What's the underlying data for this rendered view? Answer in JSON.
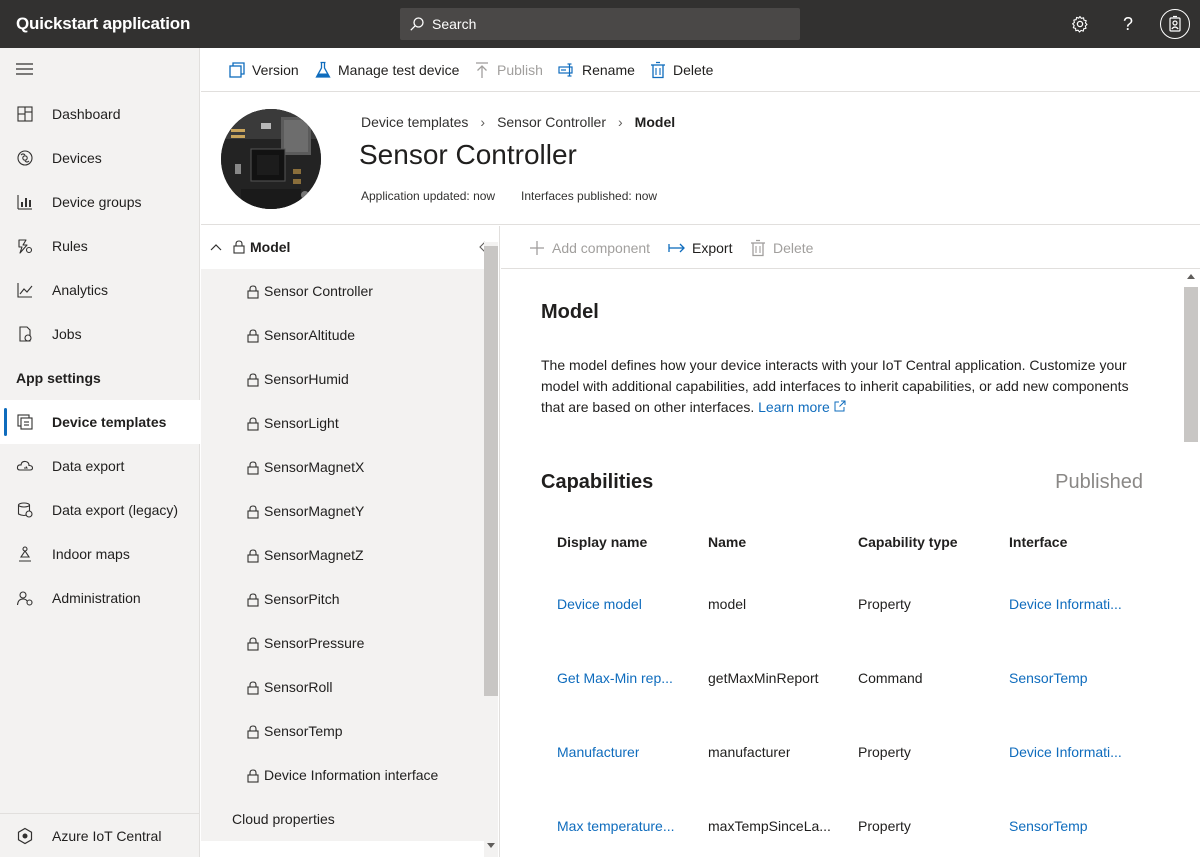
{
  "app": {
    "title": "Quickstart application"
  },
  "search": {
    "placeholder": "Search"
  },
  "sidebar": {
    "items": [
      {
        "label": "Dashboard"
      },
      {
        "label": "Devices"
      },
      {
        "label": "Device groups"
      },
      {
        "label": "Rules"
      },
      {
        "label": "Analytics"
      },
      {
        "label": "Jobs"
      }
    ],
    "section": "App settings",
    "settings_items": [
      {
        "label": "Device templates"
      },
      {
        "label": "Data export"
      },
      {
        "label": "Data export (legacy)"
      },
      {
        "label": "Indoor maps"
      },
      {
        "label": "Administration"
      }
    ],
    "footer": "Azure IoT Central"
  },
  "toolbar": {
    "version": "Version",
    "manage_test_device": "Manage test device",
    "publish": "Publish",
    "rename": "Rename",
    "delete": "Delete"
  },
  "header": {
    "breadcrumb": [
      "Device templates",
      "Sensor Controller",
      "Model"
    ],
    "title": "Sensor Controller",
    "app_updated": "Application updated: now",
    "interfaces_published": "Interfaces published: now"
  },
  "tree": {
    "root": "Model",
    "items": [
      "Sensor Controller",
      "SensorAltitude",
      "SensorHumid",
      "SensorLight",
      "SensorMagnetX",
      "SensorMagnetY",
      "SensorMagnetZ",
      "SensorPitch",
      "SensorPressure",
      "SensorRoll",
      "SensorTemp",
      "Device Information interface"
    ],
    "cloud": "Cloud properties"
  },
  "pane_toolbar": {
    "add_component": "Add component",
    "export": "Export",
    "delete": "Delete"
  },
  "content": {
    "heading": "Model",
    "description": "The model defines how your device interacts with your IoT Central application. Customize your model with additional capabilities, add interfaces to inherit capabilities, or add new components that are based on other interfaces.",
    "learn_more": "Learn more",
    "capabilities_heading": "Capabilities",
    "status": "Published",
    "columns": [
      "Display name",
      "Name",
      "Capability type",
      "Interface"
    ],
    "rows": [
      {
        "display": "Device model",
        "name": "model",
        "type": "Property",
        "interface": "Device Informati..."
      },
      {
        "display": "Get Max-Min rep...",
        "name": "getMaxMinReport",
        "type": "Command",
        "interface": "SensorTemp"
      },
      {
        "display": "Manufacturer",
        "name": "manufacturer",
        "type": "Property",
        "interface": "Device Informati..."
      },
      {
        "display": "Max temperature...",
        "name": "maxTempSinceLa...",
        "type": "Property",
        "interface": "SensorTemp"
      }
    ]
  },
  "colors": {
    "accent": "#0f6cbd",
    "topbar": "#323130",
    "sidebar": "#f3f2f1"
  }
}
